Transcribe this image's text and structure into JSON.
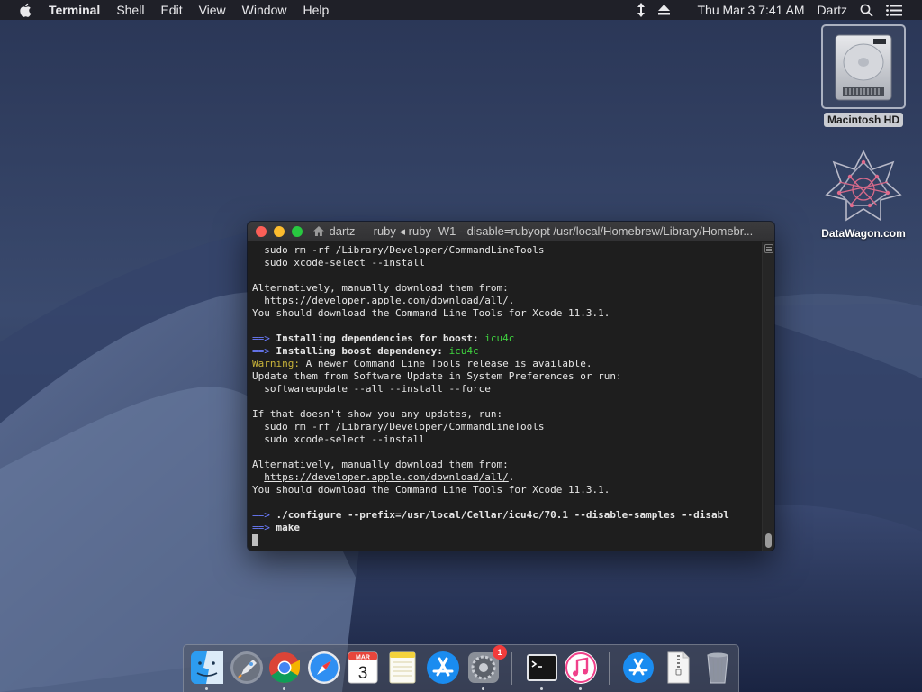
{
  "menubar": {
    "app_name": "Terminal",
    "menus": [
      "Shell",
      "Edit",
      "View",
      "Window",
      "Help"
    ],
    "clock": "Thu Mar 3  7:41 AM",
    "user": "Dartz"
  },
  "desktop": {
    "icons": [
      {
        "label": "Macintosh HD",
        "icon": "hard-drive-icon"
      },
      {
        "label": "DataWagon.com",
        "icon": "geometric-star-icon"
      }
    ]
  },
  "terminal": {
    "title": "dartz — ruby ◂ ruby -W1 --disable=rubyopt /usr/local/Homebrew/Library/Homebr...",
    "lines": [
      {
        "segs": [
          {
            "t": "  sudo rm -rf /Library/Developer/CommandLineTools"
          }
        ]
      },
      {
        "segs": [
          {
            "t": "  sudo xcode-select --install"
          }
        ]
      },
      {
        "segs": [
          {
            "t": ""
          }
        ]
      },
      {
        "segs": [
          {
            "t": "Alternatively, manually download them from:"
          }
        ]
      },
      {
        "segs": [
          {
            "t": "  "
          },
          {
            "t": "https://developer.apple.com/download/all/",
            "c": "u"
          },
          {
            "t": "."
          }
        ]
      },
      {
        "segs": [
          {
            "t": "You should download the Command Line Tools for Xcode 11.3.1."
          }
        ]
      },
      {
        "segs": [
          {
            "t": ""
          }
        ]
      },
      {
        "segs": [
          {
            "t": "==>",
            "c": "c-blue"
          },
          {
            "t": " Installing dependencies for boost: ",
            "c": "b"
          },
          {
            "t": "icu4c",
            "c": "c-green"
          }
        ]
      },
      {
        "segs": [
          {
            "t": "==>",
            "c": "c-blue"
          },
          {
            "t": " Installing boost dependency: ",
            "c": "b"
          },
          {
            "t": "icu4c",
            "c": "c-green"
          }
        ]
      },
      {
        "segs": [
          {
            "t": "Warning:",
            "c": "c-yellow"
          },
          {
            "t": " A newer Command Line Tools release is available."
          }
        ]
      },
      {
        "segs": [
          {
            "t": "Update them from Software Update in System Preferences or run:"
          }
        ]
      },
      {
        "segs": [
          {
            "t": "  softwareupdate --all --install --force"
          }
        ]
      },
      {
        "segs": [
          {
            "t": ""
          }
        ]
      },
      {
        "segs": [
          {
            "t": "If that doesn't show you any updates, run:"
          }
        ]
      },
      {
        "segs": [
          {
            "t": "  sudo rm -rf /Library/Developer/CommandLineTools"
          }
        ]
      },
      {
        "segs": [
          {
            "t": "  sudo xcode-select --install"
          }
        ]
      },
      {
        "segs": [
          {
            "t": ""
          }
        ]
      },
      {
        "segs": [
          {
            "t": "Alternatively, manually download them from:"
          }
        ]
      },
      {
        "segs": [
          {
            "t": "  "
          },
          {
            "t": "https://developer.apple.com/download/all/",
            "c": "u"
          },
          {
            "t": "."
          }
        ]
      },
      {
        "segs": [
          {
            "t": "You should download the Command Line Tools for Xcode 11.3.1."
          }
        ]
      },
      {
        "segs": [
          {
            "t": ""
          }
        ]
      },
      {
        "segs": [
          {
            "t": "==>",
            "c": "c-blue"
          },
          {
            "t": " ./configure --prefix=/usr/local/Cellar/icu4c/70.1 --disable-samples --disabl",
            "c": "b"
          }
        ]
      },
      {
        "segs": [
          {
            "t": "==>",
            "c": "c-blue"
          },
          {
            "t": " make",
            "c": "b"
          }
        ]
      }
    ]
  },
  "dock": {
    "items": [
      {
        "name": "finder-icon",
        "running": true
      },
      {
        "name": "launchpad-icon",
        "running": false
      },
      {
        "name": "chrome-icon",
        "running": true
      },
      {
        "name": "safari-icon",
        "running": false
      },
      {
        "name": "calendar-icon",
        "running": false,
        "month": "MAR",
        "day": "3"
      },
      {
        "name": "notes-icon",
        "running": false
      },
      {
        "name": "app-store-icon",
        "running": false
      },
      {
        "name": "system-preferences-icon",
        "running": true,
        "badge": "1"
      },
      {
        "name": "terminal-icon",
        "running": true
      },
      {
        "name": "itunes-icon",
        "running": true
      },
      {
        "name": "downloads-icon",
        "running": false
      },
      {
        "name": "zip-file-icon",
        "running": false
      },
      {
        "name": "trash-icon",
        "running": false
      }
    ]
  },
  "colors": {
    "term_bg": "#1e1e1e",
    "prompt_blue": "#6b7cff",
    "pkg_green": "#3fd23f",
    "warning_yellow": "#c9b43a",
    "close_red": "#fc5f57",
    "minimize_yellow": "#fdbc2e",
    "zoom_green": "#28c840"
  }
}
